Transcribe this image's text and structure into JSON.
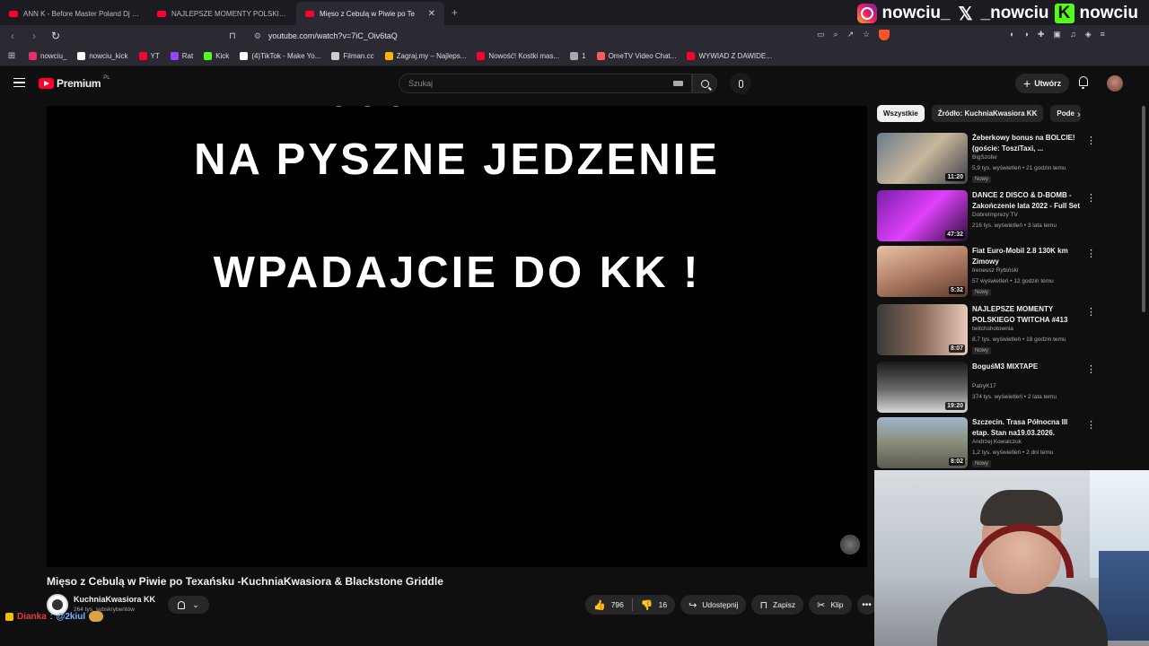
{
  "browser": {
    "tabs": [
      {
        "label": "ANN K - Before Master Poland Dj Ba",
        "active": false
      },
      {
        "label": "NAJLEPSZE MOMENTY POLSKIEGO T",
        "active": false
      },
      {
        "label": "Mięso z Cebulą w Piwie po Te",
        "active": true
      }
    ],
    "url": "youtube.com/watch?v=7iC_Oiv6taQ",
    "bookmarks": [
      {
        "label": "nowciu_",
        "color": "#e1306c"
      },
      {
        "label": "nowciu_kick",
        "color": "#ffffff"
      },
      {
        "label": "YT",
        "color": "#ff0033"
      },
      {
        "label": "Rat",
        "color": "#9146ff"
      },
      {
        "label": "Kick",
        "color": "#53fc18"
      },
      {
        "label": "(4)TikTok - Make Yo...",
        "color": "#ffffff"
      },
      {
        "label": "Filman.cc",
        "color": "#cccccc"
      },
      {
        "label": "Zagraj.my – Najleps...",
        "color": "#f5b800"
      },
      {
        "label": "Nowość! Kostki mas...",
        "color": "#ff0033"
      },
      {
        "label": "1",
        "color": "#aaaaaa"
      },
      {
        "label": "OmeTV Video Chat...",
        "color": "#ff5a5a"
      },
      {
        "label": "WYWIAD Z DAWIDE...",
        "color": "#ff0033"
      }
    ]
  },
  "overlay": {
    "instagram": "nowciu_",
    "x": "_nowciu",
    "kick": "nowciu",
    "chat_user": "Dianka",
    "chat_message": "@2kiul"
  },
  "youtube": {
    "logo_text": "Premium",
    "country": "PL",
    "search_placeholder": "Szukaj",
    "create_label": "Utwórz"
  },
  "player": {
    "top_partial": "' '  '",
    "line1": "NA PYSZNE JEDZENIE",
    "line2": "WPADAJCIE DO KK !"
  },
  "video": {
    "title": "Mięso z Cebulą w Piwie po Texańsku -KuchniaKwasiora & Blackstone Griddle",
    "channel": "KuchniaKwasiora KK",
    "subscribers": "264 tys. subskrybentów",
    "likes": "796",
    "dislikes": "16",
    "share_label": "Udostępnij",
    "save_label": "Zapisz",
    "clip_label": "Klip"
  },
  "sidebar": {
    "chips": [
      "Wszystkie",
      "Źródło: KuchniaKwasiora KK",
      "Pode"
    ],
    "recommendations": [
      {
        "title": "Żeberkowy bonus na BOLCIE! (goście: ToszíTaxi, ...",
        "channel": "BigSzofer",
        "meta": "5,9 tys. wyświetleń • 21 godzin temu",
        "badge": "Nowy",
        "duration": "11:20",
        "thumb": "linear-gradient(135deg,#6b7a8a,#c9b79c 50%,#3b3f47)"
      },
      {
        "title": "DANCE 2 DISCO & D-BOMB - Zakończenie lata 2022 - Full Set",
        "channel": "DobreImprezy TV",
        "meta": "216 tys. wyświetleń • 3 lata temu",
        "badge": "",
        "duration": "47:32",
        "thumb": "linear-gradient(135deg,#7a1fa8,#e040fb 50%,#2a0e3a)"
      },
      {
        "title": "Fiat Euro-Mobil 2.8 130K km Zimowy",
        "channel": "Ireneusz Rybiński",
        "meta": "57 wyświetleń • 12 godzin temu",
        "badge": "Nowy",
        "duration": "5:32",
        "thumb": "linear-gradient(160deg,#e4c3a8,#b7826a 45%,#5d3b2e)"
      },
      {
        "title": "NAJLEPSZE MOMENTY POLSKIEGO TWITCHA #413",
        "channel": "twitchshotownia",
        "meta": "8,7 tys. wyświetleń • 18 godzin temu",
        "badge": "Nowy",
        "duration": "8:07",
        "thumb": "linear-gradient(90deg,#3a3a3a,#8a6a5a 50%,#e8c8b8)"
      },
      {
        "title": "BoguśM3 MIXTAPE",
        "channel": "PatryK17",
        "meta": "374 tys. wyświetleń • 2 lata temu",
        "badge": "",
        "duration": "19:20",
        "thumb": "linear-gradient(180deg,#1a1a1a,#6a6a6a 55%,#d8d8d8)"
      },
      {
        "title": "Szczecin. Trasa Północna III etap. Stan na19.03.2026.",
        "channel": "Andrzej Kowalczuk",
        "meta": "1,2 tys. wyświetleń • 2 dni temu",
        "badge": "Nowy",
        "duration": "8:02",
        "thumb": "linear-gradient(180deg,#9fb6cc,#8a8c7a 50%,#5a5a50)"
      }
    ]
  }
}
